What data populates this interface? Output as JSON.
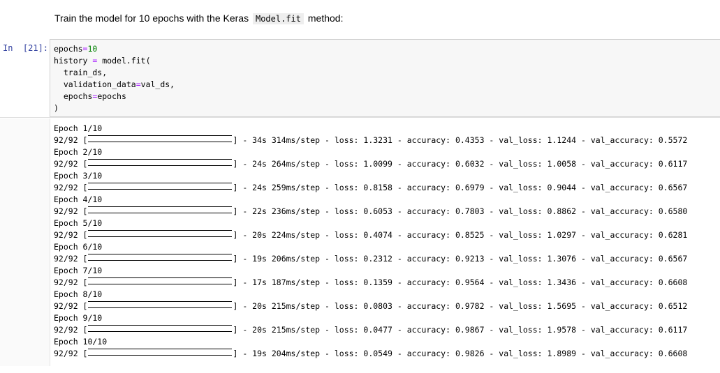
{
  "markdown": {
    "prefix": "Train the model for 10 epochs with the Keras ",
    "code": "Model.fit",
    "suffix": " method:"
  },
  "cell": {
    "prompt": "In  [21]:",
    "code_lines": [
      [
        {
          "t": "epochs",
          "c": ""
        },
        {
          "t": "=",
          "c": "op"
        },
        {
          "t": "10",
          "c": "num"
        }
      ],
      [
        {
          "t": "history ",
          "c": ""
        },
        {
          "t": "=",
          "c": "op"
        },
        {
          "t": " model.fit(",
          "c": ""
        }
      ],
      [
        {
          "t": "  train_ds,",
          "c": ""
        }
      ],
      [
        {
          "t": "  validation_data",
          "c": ""
        },
        {
          "t": "=",
          "c": "op"
        },
        {
          "t": "val_ds,",
          "c": ""
        }
      ],
      [
        {
          "t": "  epochs",
          "c": ""
        },
        {
          "t": "=",
          "c": "op"
        },
        {
          "t": "epochs",
          "c": ""
        }
      ],
      [
        {
          "t": ")",
          "c": ""
        }
      ]
    ]
  },
  "output": {
    "step_prefix": "92/92 [",
    "epochs": [
      {
        "header": "Epoch 1/10",
        "stats": "] - 34s 314ms/step - loss: 1.3231 - accuracy: 0.4353 - val_loss: 1.1244 - val_accuracy: 0.5572"
      },
      {
        "header": "Epoch 2/10",
        "stats": "] - 24s 264ms/step - loss: 1.0099 - accuracy: 0.6032 - val_loss: 1.0058 - val_accuracy: 0.6117"
      },
      {
        "header": "Epoch 3/10",
        "stats": "] - 24s 259ms/step - loss: 0.8158 - accuracy: 0.6979 - val_loss: 0.9044 - val_accuracy: 0.6567"
      },
      {
        "header": "Epoch 4/10",
        "stats": "] - 22s 236ms/step - loss: 0.6053 - accuracy: 0.7803 - val_loss: 0.8862 - val_accuracy: 0.6580"
      },
      {
        "header": "Epoch 5/10",
        "stats": "] - 20s 224ms/step - loss: 0.4074 - accuracy: 0.8525 - val_loss: 1.0297 - val_accuracy: 0.6281"
      },
      {
        "header": "Epoch 6/10",
        "stats": "] - 19s 206ms/step - loss: 0.2312 - accuracy: 0.9213 - val_loss: 1.3076 - val_accuracy: 0.6567"
      },
      {
        "header": "Epoch 7/10",
        "stats": "] - 17s 187ms/step - loss: 0.1359 - accuracy: 0.9564 - val_loss: 1.3436 - val_accuracy: 0.6608"
      },
      {
        "header": "Epoch 8/10",
        "stats": "] - 20s 215ms/step - loss: 0.0803 - accuracy: 0.9782 - val_loss: 1.5695 - val_accuracy: 0.6512"
      },
      {
        "header": "Epoch 9/10",
        "stats": "] - 20s 215ms/step - loss: 0.0477 - accuracy: 0.9867 - val_loss: 1.9578 - val_accuracy: 0.6117"
      },
      {
        "header": "Epoch 10/10",
        "stats": "] - 19s 204ms/step - loss: 0.0549 - accuracy: 0.9826 - val_loss: 1.8989 - val_accuracy: 0.6608"
      }
    ]
  }
}
